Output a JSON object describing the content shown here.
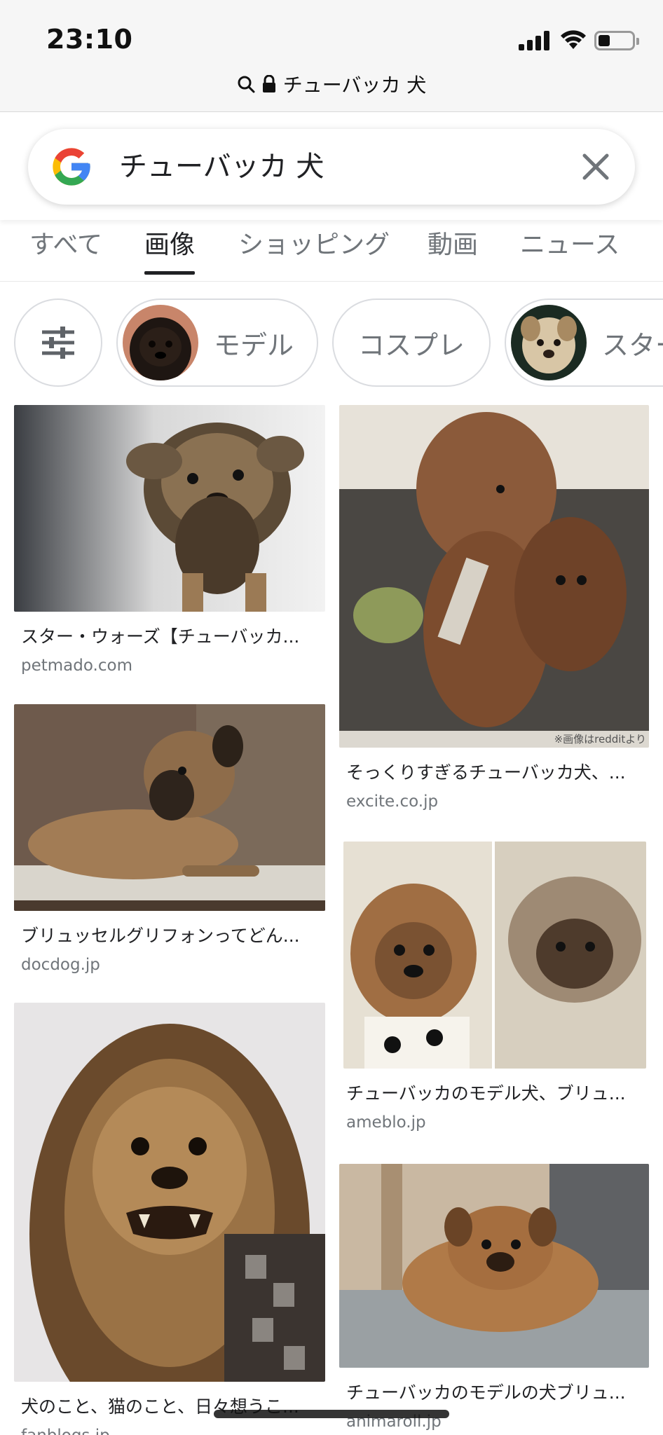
{
  "status_bar": {
    "time": "23:10",
    "battery_level": 0.3
  },
  "url_bar": {
    "text": "チューバッカ 犬"
  },
  "search": {
    "query": "チューバッカ 犬",
    "logo_colors": [
      "#4285F4",
      "#EA4335",
      "#FBBC05",
      "#34A853"
    ]
  },
  "tabs": [
    {
      "label": "すべて",
      "active": false
    },
    {
      "label": "画像",
      "active": true
    },
    {
      "label": "ショッピング",
      "active": false
    },
    {
      "label": "動画",
      "active": false
    },
    {
      "label": "ニュース",
      "active": false
    }
  ],
  "chips": [
    {
      "icon": "tune-icon"
    },
    {
      "label": "モデル",
      "thumb": "dog-thumbnail"
    },
    {
      "label": "コスプレ"
    },
    {
      "label": "スター",
      "thumb": "dog-thumbnail"
    }
  ],
  "results": [
    {
      "title": "スター・ウォーズ【チューバッカ...",
      "source": "petmado.com"
    },
    {
      "title": "そっくりすぎるチューバッカ犬、...",
      "source": "excite.co.jp",
      "watermark": "※画像はredditより"
    },
    {
      "title": "ブリュッセルグリフォンってどん...",
      "source": "docdog.jp"
    },
    {
      "title": "チューバッカのモデル犬、ブリュ...",
      "source": "ameblo.jp"
    },
    {
      "title": "犬のこと、猫のこと、日々想うこ...",
      "source": "fanblogs.jp"
    },
    {
      "title": "チューバッカのモデルの犬ブリュ...",
      "source": "animaroll.jp"
    }
  ]
}
